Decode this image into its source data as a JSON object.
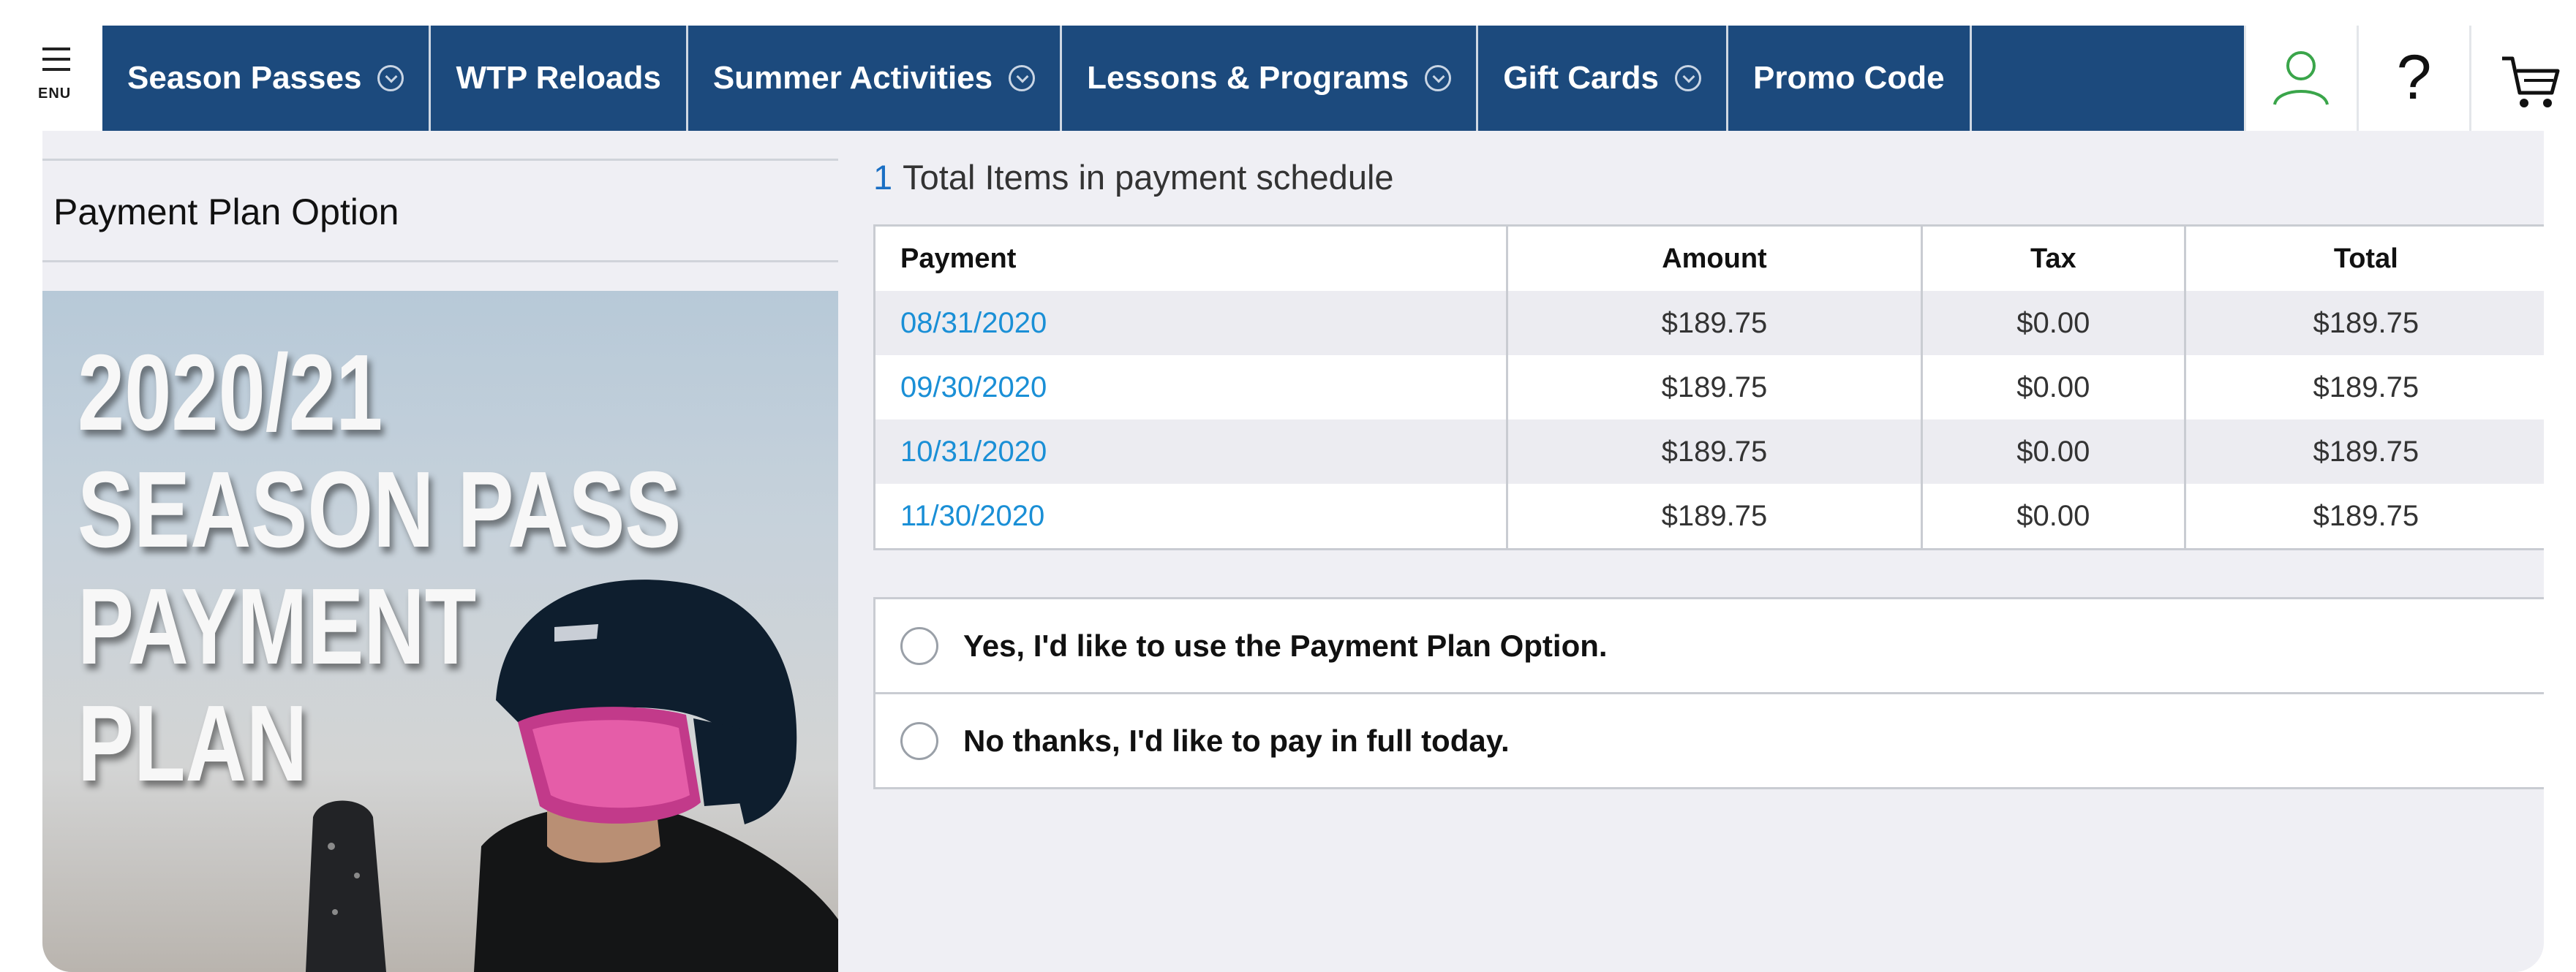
{
  "header": {
    "menu_label": "ENU",
    "nav": [
      {
        "label": "Season Passes",
        "has_dropdown": true
      },
      {
        "label": "WTP Reloads",
        "has_dropdown": false
      },
      {
        "label": "Summer Activities",
        "has_dropdown": true
      },
      {
        "label": "Lessons & Programs",
        "has_dropdown": true
      },
      {
        "label": "Gift Cards",
        "has_dropdown": true
      },
      {
        "label": "Promo Code",
        "has_dropdown": false
      }
    ],
    "help_glyph": "?",
    "icons": [
      "user-icon",
      "help-icon",
      "cart-icon"
    ],
    "nav_color": "#1c4a7d",
    "user_icon_color": "#3aa54a"
  },
  "left": {
    "section_title": "Payment Plan Option",
    "promo_lines": [
      "2020/21",
      "SEASON PASS",
      "PAYMENT",
      "PLAN"
    ]
  },
  "schedule": {
    "count": "1",
    "summary": "Total Items in payment schedule",
    "columns": [
      "Payment",
      "Amount",
      "Tax",
      "Total"
    ],
    "rows": [
      {
        "date": "08/31/2020",
        "amount": "$189.75",
        "tax": "$0.00",
        "total": "$189.75"
      },
      {
        "date": "09/30/2020",
        "amount": "$189.75",
        "tax": "$0.00",
        "total": "$189.75"
      },
      {
        "date": "10/31/2020",
        "amount": "$189.75",
        "tax": "$0.00",
        "total": "$189.75"
      },
      {
        "date": "11/30/2020",
        "amount": "$189.75",
        "tax": "$0.00",
        "total": "$189.75"
      }
    ],
    "link_color": "#1a8fd6"
  },
  "options": [
    {
      "label": "Yes, I'd like to use the Payment Plan Option.",
      "selected": false
    },
    {
      "label": "No thanks, I'd like to pay in full today.",
      "selected": false
    }
  ]
}
